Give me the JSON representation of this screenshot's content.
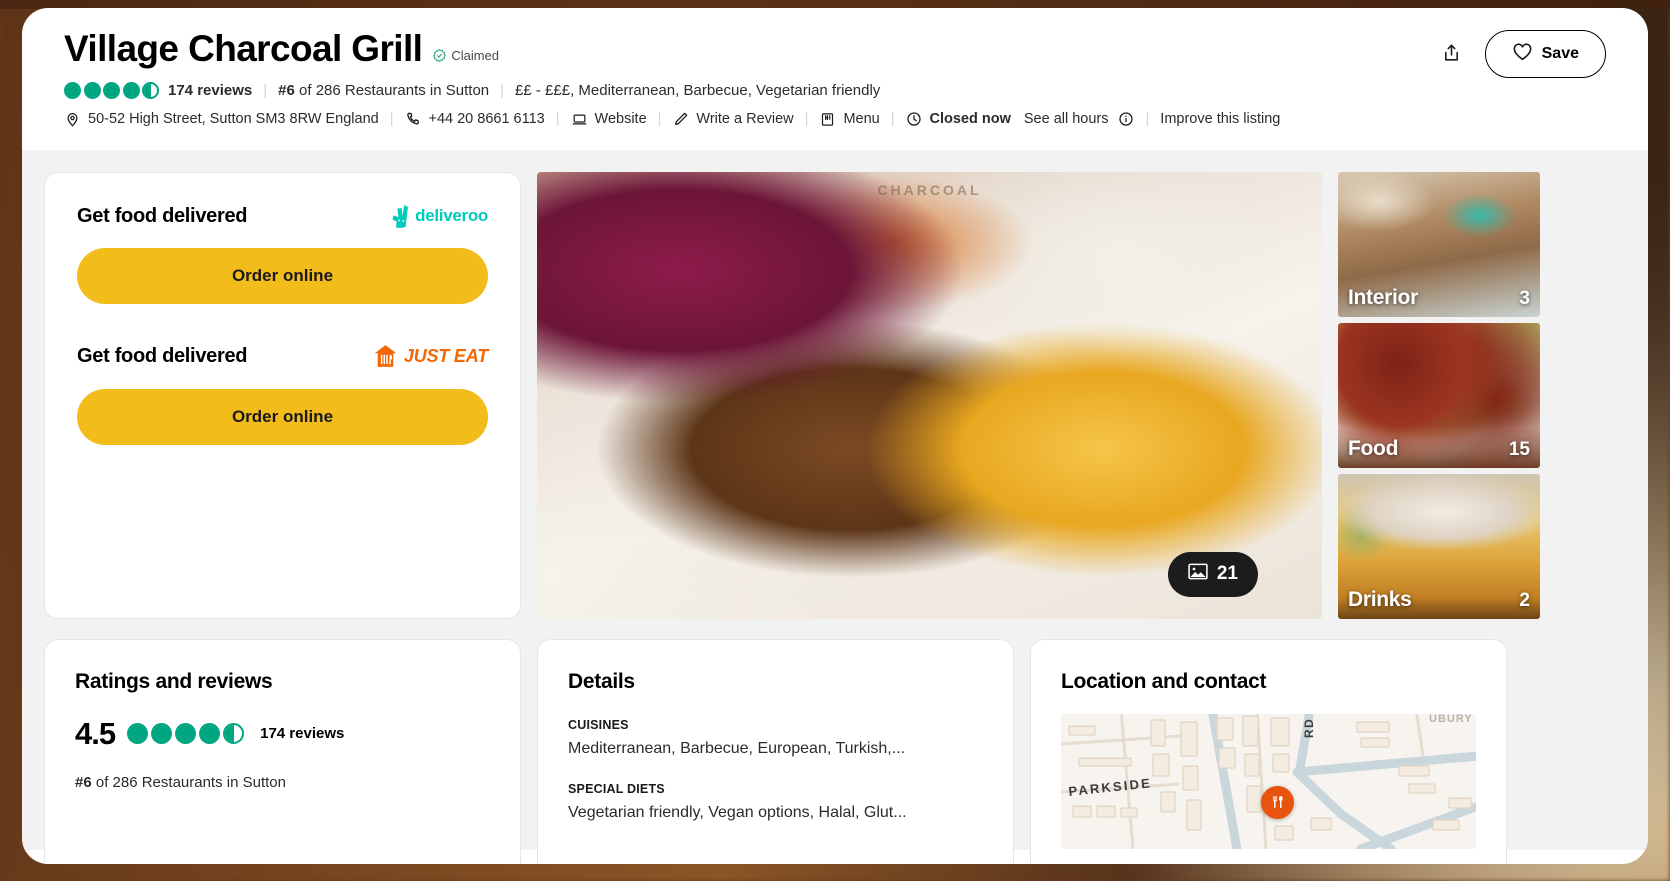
{
  "header": {
    "title": "Village Charcoal Grill",
    "claimed_label": "Claimed",
    "claimed_icon": "check-badge-icon",
    "rating": 4.5,
    "reviews_label": "174 reviews",
    "rank_label": "#6 of 286 Restaurants in Sutton",
    "price_cuisine": "££ - £££, Mediterranean, Barbecue, Vegetarian friendly",
    "address": "50-52 High Street, Sutton SM3 8RW England",
    "phone": "+44 20 8661 6113",
    "website_label": "Website",
    "write_review_label": "Write a Review",
    "menu_label": "Menu",
    "status_label": "Closed now",
    "hours_label": "See all hours",
    "improve_label": "Improve this listing",
    "share_icon": "share-icon",
    "save_label": "Save",
    "save_icon": "heart-icon",
    "location_icon": "map-pin-icon",
    "phone_icon": "phone-icon",
    "website_icon": "laptop-icon",
    "review_icon": "pencil-icon",
    "menu_icon": "menu-book-icon",
    "clock_icon": "clock-icon",
    "info_icon": "info-circle-icon"
  },
  "delivery": {
    "blocks": [
      {
        "title": "Get food delivered",
        "provider": "deliveroo",
        "provider_icon": "deliveroo-logo-icon",
        "button": "Order online"
      },
      {
        "title": "Get food delivered",
        "provider": "JUST EAT",
        "provider_icon": "just-eat-logo-icon",
        "button": "Order online"
      }
    ]
  },
  "gallery": {
    "hero_caption": "CHARCOAL",
    "photo_count": "21",
    "photo_icon": "image-icon",
    "thumbs": [
      {
        "label": "Interior",
        "count": "3"
      },
      {
        "label": "Food",
        "count": "15"
      },
      {
        "label": "Drinks",
        "count": "2"
      }
    ]
  },
  "ratings_card": {
    "heading": "Ratings and reviews",
    "score": "4.5",
    "reviews_label": "174 reviews",
    "rank_prefix": "#6",
    "rank_rest": " of 286 Restaurants in Sutton"
  },
  "details_card": {
    "heading": "Details",
    "rows": [
      {
        "label": "CUISINES",
        "value": "Mediterranean, Barbecue, European, Turkish,..."
      },
      {
        "label": "SPECIAL DIETS",
        "value": "Vegetarian friendly, Vegan options, Halal, Glut..."
      }
    ]
  },
  "location_card": {
    "heading": "Location and contact",
    "map_labels": [
      "PARKSIDE",
      "RD"
    ],
    "pin_icon": "restaurant-pin-icon"
  },
  "colors": {
    "accent_green": "#00a680",
    "order_yellow": "#f2bc1b",
    "deliveroo_teal": "#00ccbc",
    "justeat_orange": "#f36805",
    "pin_orange": "#e8530e"
  }
}
